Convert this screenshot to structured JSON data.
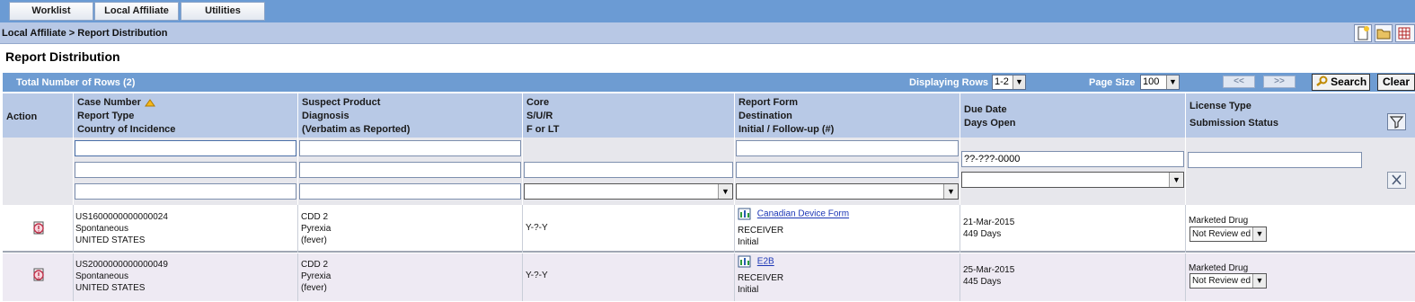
{
  "nav": {
    "tabs": [
      "Worklist",
      "Local Affiliate",
      "Utilities"
    ]
  },
  "breadcrumb": "Local Affiliate > Report Distribution",
  "page_title": "Report Distribution",
  "grid_header": {
    "total_rows": "Total Number of Rows (2)",
    "displaying_rows_label": "Displaying Rows",
    "displaying_rows_value": "1-2",
    "page_size_label": "Page Size",
    "page_size_value": "100",
    "prev_label": "<<",
    "next_label": ">>",
    "search_label": "Search",
    "clear_label": "Clear"
  },
  "columns": {
    "action": "Action",
    "case": [
      "Case Number",
      "Report Type",
      "Country of Incidence"
    ],
    "product": [
      "Suspect Product",
      "Diagnosis",
      "(Verbatim as Reported)"
    ],
    "core": [
      "Core",
      "S/U/R",
      "F or LT"
    ],
    "report": [
      "Report Form",
      "Destination",
      "Initial / Follow-up (#)"
    ],
    "due": [
      "Due Date",
      "Days Open"
    ],
    "license": [
      "License Type",
      "Submission Status"
    ]
  },
  "filters": {
    "due_date_value": "??-???-0000"
  },
  "rows": [
    {
      "case_number": "US1600000000000024",
      "report_type": "Spontaneous",
      "country": "UNITED STATES",
      "product": "CDD 2",
      "diagnosis": "Pyrexia",
      "verbatim": "(fever)",
      "core": "Y-?-Y",
      "report_form": "Canadian Device Form",
      "destination": "RECEIVER",
      "initial": "Initial",
      "due_date": "21-Mar-2015",
      "days_open": "449 Days",
      "license_type": "Marketed Drug",
      "status": "Not Review ed"
    },
    {
      "case_number": "US2000000000000049",
      "report_type": "Spontaneous",
      "country": "UNITED STATES",
      "product": "CDD 2",
      "diagnosis": "Pyrexia",
      "verbatim": "(fever)",
      "core": "Y-?-Y",
      "report_form": "E2B",
      "destination": "RECEIVER",
      "initial": "Initial",
      "due_date": "25-Mar-2015",
      "days_open": "445 Days",
      "license_type": "Marketed Drug",
      "status": "Not Review ed"
    }
  ],
  "colors": {
    "nav_bar": "#6b9bd4",
    "header_blue": "#6e9cd2",
    "column_header": "#b8c9e6",
    "link": "#1a35b5"
  }
}
